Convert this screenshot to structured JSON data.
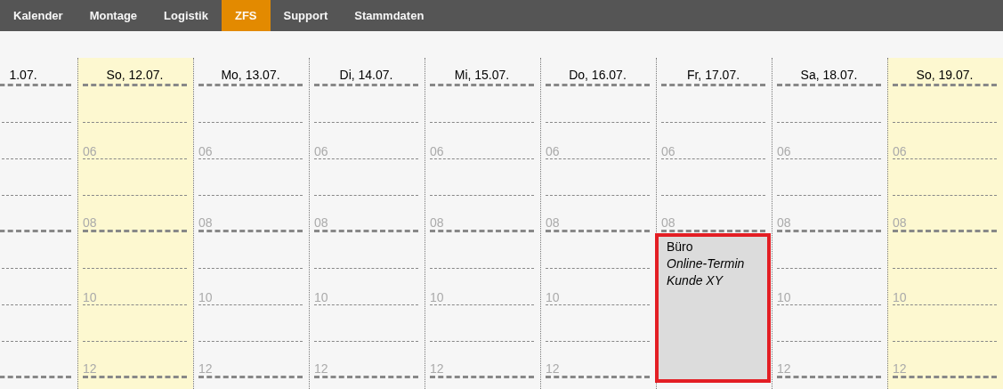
{
  "nav": {
    "tabs": [
      {
        "label": "Kalender",
        "selected": false
      },
      {
        "label": "Montage",
        "selected": false
      },
      {
        "label": "Logistik",
        "selected": false
      },
      {
        "label": "ZFS",
        "selected": true
      },
      {
        "label": "Support",
        "selected": false
      },
      {
        "label": "Stammdaten",
        "selected": false
      }
    ]
  },
  "calendar": {
    "days": [
      {
        "kind": "partial",
        "label": "1.07.",
        "weekend": false
      },
      {
        "kind": "full",
        "label": "So, 12.07.",
        "weekend": true,
        "hours": [
          "06",
          "08",
          "10",
          "12"
        ]
      },
      {
        "kind": "full",
        "label": "Mo, 13.07.",
        "weekend": false,
        "hours": [
          "06",
          "08",
          "10",
          "12"
        ]
      },
      {
        "kind": "full",
        "label": "Di, 14.07.",
        "weekend": false,
        "hours": [
          "06",
          "08",
          "10",
          "12"
        ]
      },
      {
        "kind": "full",
        "label": "Mi, 15.07.",
        "weekend": false,
        "hours": [
          "06",
          "08",
          "10",
          "12"
        ]
      },
      {
        "kind": "full",
        "label": "Do, 16.07.",
        "weekend": false,
        "hours": [
          "06",
          "08",
          "10",
          "12"
        ]
      },
      {
        "kind": "full",
        "label": "Fr, 17.07.",
        "weekend": false,
        "hours": [
          "06",
          "08"
        ],
        "events": [
          {
            "title": "Büro",
            "details": [
              "Online-Termin",
              "Kunde XY"
            ]
          }
        ]
      },
      {
        "kind": "full",
        "label": "Sa, 18.07.",
        "weekend": false,
        "hours": [
          "06",
          "08",
          "10",
          "12"
        ]
      },
      {
        "kind": "full",
        "label": "So, 19.07.",
        "weekend": true,
        "hours": [
          "06",
          "08",
          "10",
          "12"
        ]
      }
    ]
  }
}
